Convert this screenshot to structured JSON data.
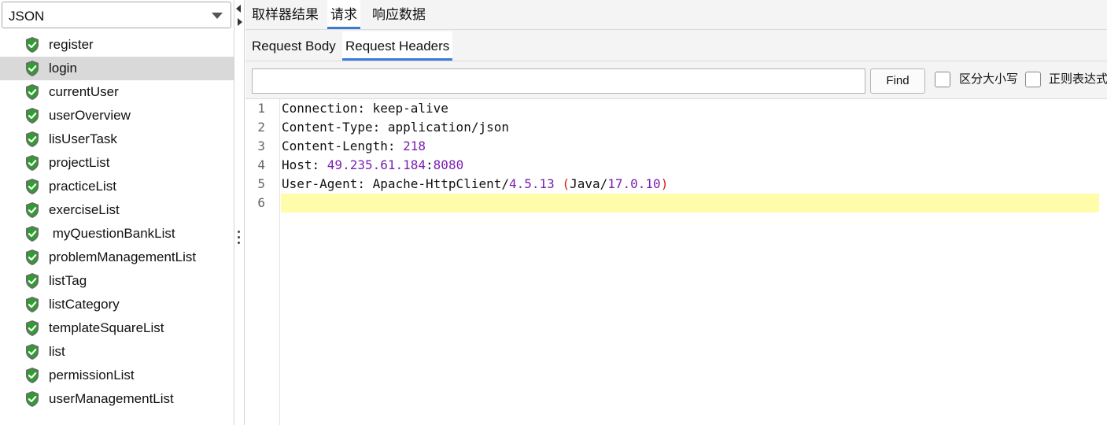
{
  "left_panel": {
    "renderer_select": {
      "value": "JSON"
    },
    "tree_items": [
      {
        "label": "register",
        "selected": false,
        "status_icon": "success-shield-icon"
      },
      {
        "label": "login",
        "selected": true,
        "status_icon": "success-shield-icon"
      },
      {
        "label": "currentUser",
        "selected": false,
        "status_icon": "success-shield-icon"
      },
      {
        "label": "userOverview",
        "selected": false,
        "status_icon": "success-shield-icon"
      },
      {
        "label": "lisUserTask",
        "selected": false,
        "status_icon": "success-shield-icon"
      },
      {
        "label": "projectList",
        "selected": false,
        "status_icon": "success-shield-icon"
      },
      {
        "label": "practiceList",
        "selected": false,
        "status_icon": "success-shield-icon"
      },
      {
        "label": "exerciseList",
        "selected": false,
        "status_icon": "success-shield-icon"
      },
      {
        "label": " myQuestionBankList",
        "selected": false,
        "status_icon": "success-shield-icon"
      },
      {
        "label": "problemManagementList",
        "selected": false,
        "status_icon": "success-shield-icon"
      },
      {
        "label": "listTag",
        "selected": false,
        "status_icon": "success-shield-icon"
      },
      {
        "label": "listCategory",
        "selected": false,
        "status_icon": "success-shield-icon"
      },
      {
        "label": "templateSquareList",
        "selected": false,
        "status_icon": "success-shield-icon"
      },
      {
        "label": "list",
        "selected": false,
        "status_icon": "success-shield-icon"
      },
      {
        "label": "permissionList",
        "selected": false,
        "status_icon": "success-shield-icon"
      },
      {
        "label": "userManagementList",
        "selected": false,
        "status_icon": "success-shield-icon"
      }
    ]
  },
  "right_panel": {
    "top_tabs": [
      {
        "label": "取样器结果",
        "active": false
      },
      {
        "label": "请求",
        "active": true
      },
      {
        "label": "响应数据",
        "active": false
      }
    ],
    "sub_tabs": [
      {
        "label": "Request Body",
        "active": false
      },
      {
        "label": "Request Headers",
        "active": true
      }
    ],
    "search": {
      "value": "",
      "placeholder": "",
      "find_label": "Find",
      "case_sensitive_label": "区分大小写",
      "regex_label": "正则表达式"
    },
    "editor": {
      "line_numbers": [
        "1",
        "2",
        "3",
        "4",
        "5",
        "6"
      ],
      "lines": [
        {
          "key": "Connection",
          "sep": ": ",
          "value": "keep-alive"
        },
        {
          "key": "Content-Type",
          "sep": ": ",
          "value": "application/json"
        },
        {
          "key": "Content-Length",
          "sep": ": ",
          "value": "218"
        },
        {
          "key": "Host",
          "sep": ": ",
          "value": "49.235.61.184:8080"
        },
        {
          "key": "User-Agent",
          "sep": ": ",
          "value": "Apache-HttpClient/4.5.13 (Java/17.0.10)"
        },
        {
          "key": "",
          "sep": "",
          "value": ""
        }
      ],
      "current_line": 6
    }
  },
  "colors": {
    "selection": "#d9d9d9",
    "tab_accent": "#3a7bd5",
    "current_line": "#fffcaa",
    "number_token": "#7a1fb0",
    "paren_token": "#d01b1b",
    "success_green": "#2e9e2e"
  }
}
